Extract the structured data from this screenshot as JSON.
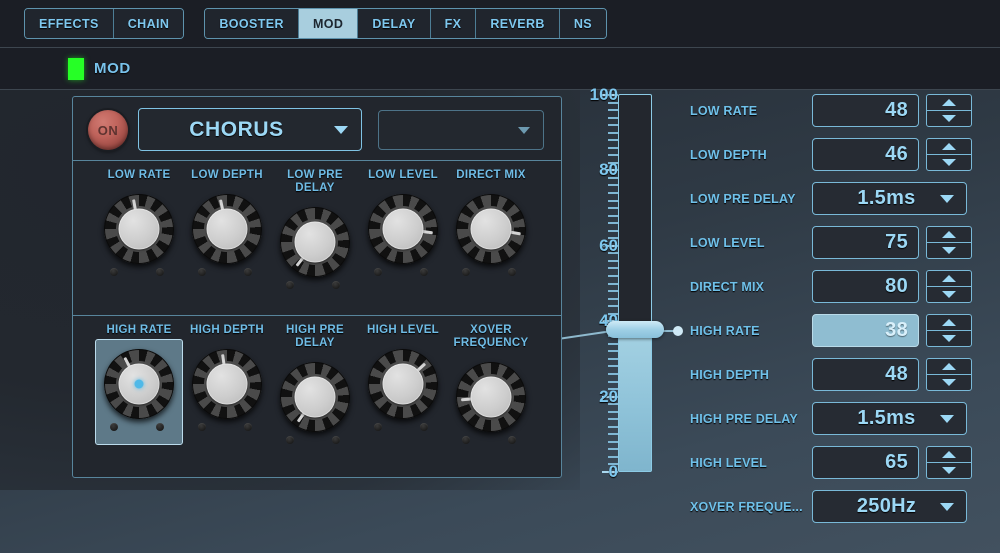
{
  "tabs": {
    "group1": [
      {
        "label": "EFFECTS",
        "active": false
      },
      {
        "label": "CHAIN",
        "active": false
      }
    ],
    "group2": [
      {
        "label": "BOOSTER",
        "active": false
      },
      {
        "label": "MOD",
        "active": true
      },
      {
        "label": "DELAY",
        "active": false
      },
      {
        "label": "FX",
        "active": false
      },
      {
        "label": "REVERB",
        "active": false
      },
      {
        "label": "NS",
        "active": false
      }
    ]
  },
  "section": {
    "title": "MOD",
    "led_color": "#26ff26"
  },
  "panel": {
    "power_button": "ON",
    "effect_select": "CHORUS",
    "aux_select": "",
    "knob_rows": [
      {
        "knobs": [
          {
            "label": "LOW RATE",
            "angle": -10,
            "selected": false
          },
          {
            "label": "LOW DEPTH",
            "angle": -12,
            "selected": false
          },
          {
            "label": "LOW PRE DELAY",
            "angle": 218,
            "selected": false
          },
          {
            "label": "LOW LEVEL",
            "angle": 98,
            "selected": false
          },
          {
            "label": "DIRECT MIX",
            "angle": 100,
            "selected": false
          }
        ]
      },
      {
        "knobs": [
          {
            "label": "HIGH RATE",
            "angle": -28,
            "selected": true
          },
          {
            "label": "HIGH DEPTH",
            "angle": -8,
            "selected": false
          },
          {
            "label": "HIGH PRE DELAY",
            "angle": 215,
            "selected": false
          },
          {
            "label": "HIGH LEVEL",
            "angle": 48,
            "selected": false
          },
          {
            "label": "XOVER FREQUENCY",
            "angle": 265,
            "selected": false
          }
        ]
      }
    ]
  },
  "slider": {
    "min": 0,
    "max": 100,
    "value": 38,
    "tick_labels": [
      "100",
      "80",
      "60",
      "40",
      "20",
      "0"
    ],
    "tick_values": [
      100,
      80,
      60,
      40,
      20,
      0
    ],
    "fill_color": "#8fc3d9",
    "accent_color": "#8ccbe6"
  },
  "params": [
    {
      "label": "LOW RATE",
      "value": "48",
      "type": "number",
      "selected": false
    },
    {
      "label": "LOW DEPTH",
      "value": "46",
      "type": "number",
      "selected": false
    },
    {
      "label": "LOW PRE DELAY",
      "value": "1.5ms",
      "type": "dropdown",
      "selected": false
    },
    {
      "label": "LOW LEVEL",
      "value": "75",
      "type": "number",
      "selected": false
    },
    {
      "label": "DIRECT MIX",
      "value": "80",
      "type": "number",
      "selected": false
    },
    {
      "label": "HIGH RATE",
      "value": "38",
      "type": "number",
      "selected": true
    },
    {
      "label": "HIGH DEPTH",
      "value": "48",
      "type": "number",
      "selected": false
    },
    {
      "label": "HIGH PRE DELAY",
      "value": "1.5ms",
      "type": "dropdown",
      "selected": false
    },
    {
      "label": "HIGH LEVEL",
      "value": "65",
      "type": "number",
      "selected": false
    },
    {
      "label": "XOVER FREQUE...",
      "value": "250Hz",
      "type": "dropdown",
      "selected": false
    }
  ]
}
